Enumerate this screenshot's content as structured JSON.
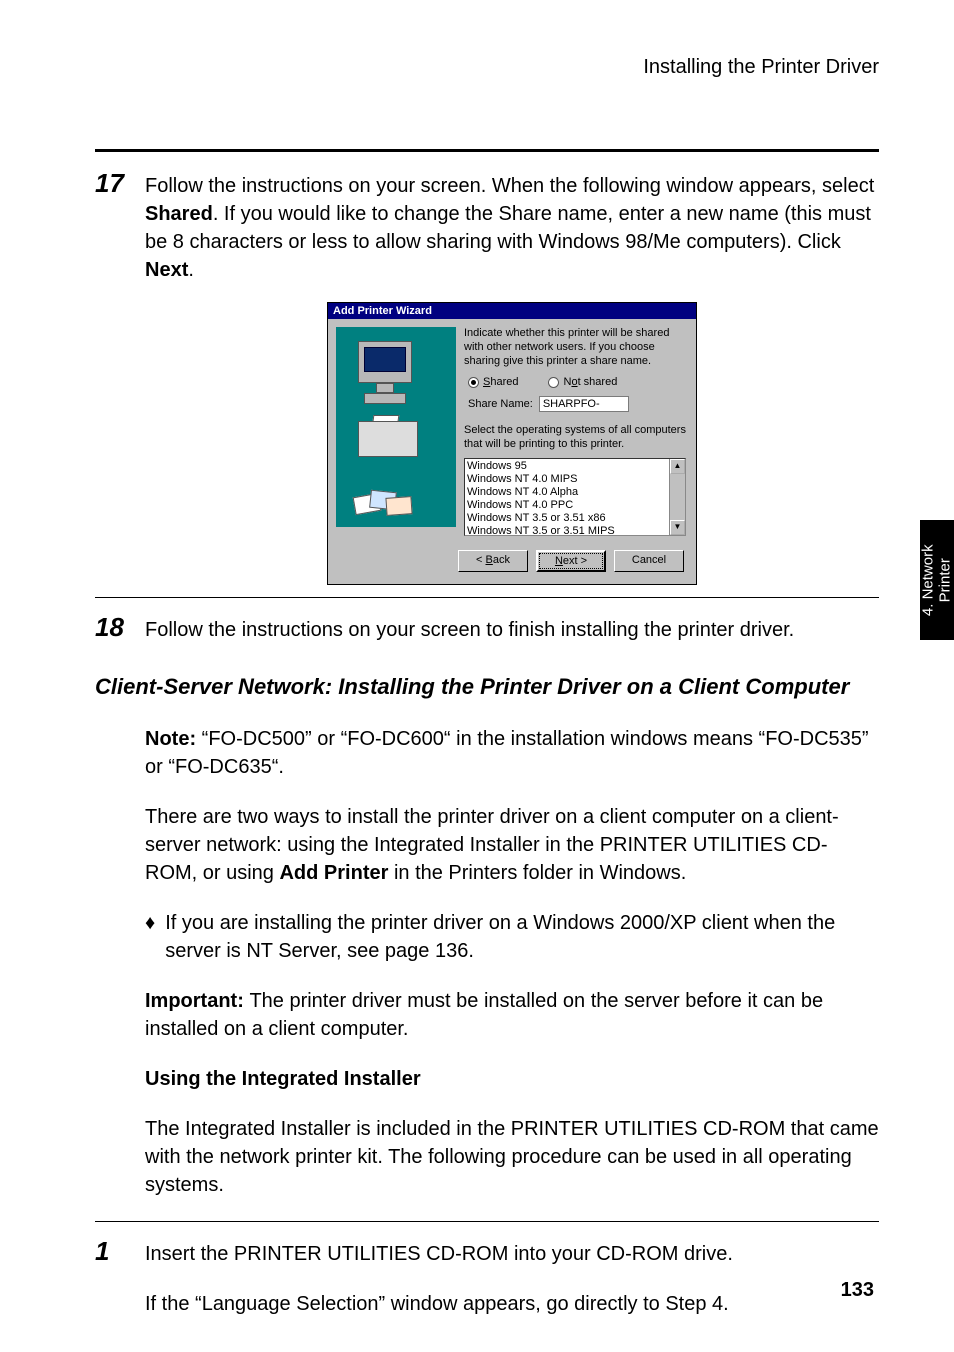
{
  "running_header": "Installing the Printer Driver",
  "side_tab": "4. Network\nPrinter",
  "page_number": "133",
  "step17": {
    "num": "17",
    "text_prefix": "Follow the instructions on your screen. When the following window appears, select ",
    "bold1": "Shared",
    "text_mid": ". If you would like to change the Share name, enter a new name (this must be 8 characters or less to allow sharing with Windows 98/Me computers). Click ",
    "bold2": "Next",
    "text_suffix": "."
  },
  "wizard": {
    "title": "Add Printer Wizard",
    "instr": "Indicate whether this printer will be shared with other network users.  If you choose sharing give this printer a share name.",
    "radio_shared_u": "S",
    "radio_shared": "hared",
    "radio_not_u": "o",
    "radio_not_pre": "N",
    "radio_not_post": "t shared",
    "share_label": "Share Name:",
    "share_value": "SHARPFO-",
    "instr2": "Select the operating systems of all computers that will be printing to this printer.",
    "os": [
      "Windows 95",
      "Windows NT 4.0 MIPS",
      "Windows NT 4.0 Alpha",
      "Windows NT 4.0 PPC",
      "Windows NT 3.5 or 3.51 x86",
      "Windows NT 3.5 or 3.51 MIPS"
    ],
    "btn_back_pre": "< ",
    "btn_back_u": "B",
    "btn_back_post": "ack",
    "btn_next_u": "N",
    "btn_next_post": "ext >",
    "btn_cancel": "Cancel"
  },
  "step18": {
    "num": "18",
    "text": "Follow the instructions on your screen to finish installing the printer driver."
  },
  "section_title": "Client-Server Network: Installing the Printer Driver on a Client Computer",
  "note": {
    "bold": "Note: ",
    "text": "“FO-DC500” or “FO-DC600“ in the installation windows means “FO-DC535” or “FO-DC635“."
  },
  "para2_pre": "There are two ways to install the printer driver on a client computer on a client-server network: using the Integrated Installer in the PRINTER UTILITIES CD-ROM, or using ",
  "para2_bold": "Add Printer",
  "para2_post": " in the Printers folder in Windows.",
  "bullet1": "If you are installing the printer driver on a Windows 2000/XP client when the server is NT Server, see page 136.",
  "important": {
    "bold": "Important: ",
    "text": "The printer driver must be installed on the server before it can be installed on a client computer."
  },
  "subheading": "Using the Integrated Installer",
  "para3": "The Integrated Installer is included in the PRINTER UTILITIES CD-ROM that came with the network printer kit. The following procedure can be used in all operating systems.",
  "step1": {
    "num": "1",
    "text": "Insert the PRINTER UTILITIES CD-ROM into your CD-ROM drive.",
    "text2": "If the “Language Selection” window appears, go directly to Step 4."
  }
}
